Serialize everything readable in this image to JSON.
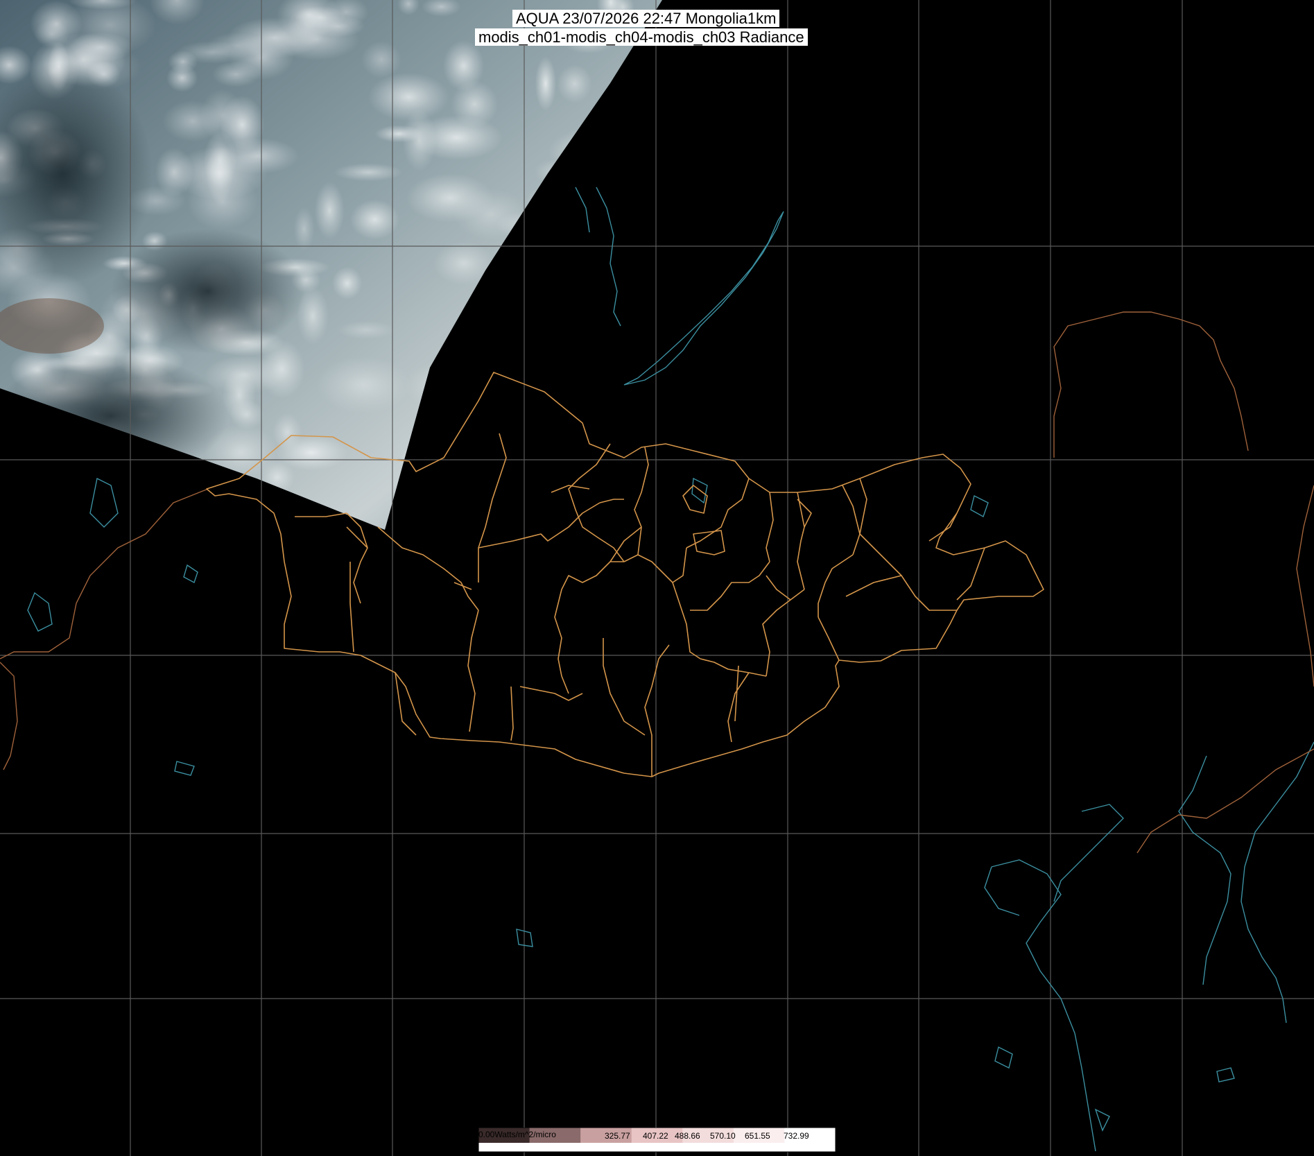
{
  "title": {
    "line1": "AQUA 23/07/2026 22:47 Mongolia1km",
    "line2": "modis_ch01-modis_ch04-modis_ch03 Radiance"
  },
  "colorbar": {
    "label_left": "0.00Watts/m^2/micro",
    "values": [
      "325.77",
      "407.22",
      "488.66",
      "570.10",
      "651.55",
      "732.99"
    ],
    "colors": [
      "#3a2a2a",
      "#8a6a6a",
      "#c9a0a0",
      "#e8c4c4",
      "#f3dcdc",
      "#fbeeee",
      "#ffffff"
    ]
  },
  "map": {
    "background": "#000000",
    "graticule_color": "#5a5a5a",
    "admin_border_color": "#d4954a",
    "coastline_color": "#3b8fa0",
    "international_border_color": "#a0623a",
    "imagery": "true-color MODIS swath (clouds over Siberia)"
  }
}
